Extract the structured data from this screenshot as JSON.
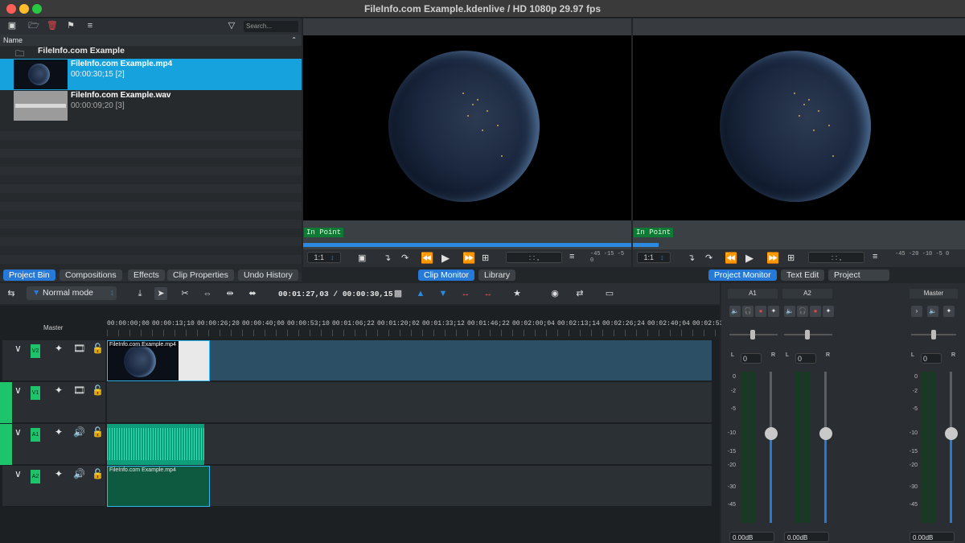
{
  "window": {
    "title": "FileInfo.com Example.kdenlive / HD 1080p 29.97 fps"
  },
  "bin": {
    "search_placeholder": "Search...",
    "column_header": "Name",
    "folder": "FileInfo.com Example",
    "clips": [
      {
        "name": "FileInfo.com Example.mp4",
        "duration": "00:00:30;15 [2]"
      },
      {
        "name": "FileInfo.com Example.wav",
        "duration": "00:00:09;20 [3]"
      }
    ],
    "tabs": [
      "Project Bin",
      "Compositions",
      "Effects",
      "Clip Properties",
      "Undo History"
    ]
  },
  "clip_monitor": {
    "in_point": "In Point",
    "zoom": "1:1",
    "timecode": ": : ,",
    "meter_labels": [
      "-45",
      "-15",
      "-5",
      "0"
    ],
    "tabs": [
      "Clip Monitor",
      "Library"
    ]
  },
  "project_monitor": {
    "in_point": "In Point",
    "zoom": "1:1",
    "timecode": ": : ,",
    "meter_labels": [
      "-45",
      "-20",
      "-10",
      "-5",
      "0"
    ],
    "tabs": [
      "Project Monitor",
      "Text Edit",
      "Project Notes"
    ]
  },
  "timeline": {
    "mode": "Normal mode",
    "timecode": "00:01:27,03 / 00:00:30,15",
    "master_label": "Master",
    "ruler": [
      "00:00:00;00",
      "00:00:13;10",
      "00:00:26;20",
      "00:00:40;00",
      "00:00:53;10",
      "00:01:06;22",
      "00:01:20;02",
      "00:01:33;12",
      "00:01:46;22",
      "00:02:00;04",
      "00:02:13;14",
      "00:02:26;24",
      "00:02:40;04",
      "00:02:53"
    ],
    "tracks": [
      "V2",
      "V1",
      "A1",
      "A2"
    ],
    "clip_v2": "FileInfo.com Example.mp4",
    "clip_a2": "FileInfo.com Example.mp4"
  },
  "mixer": {
    "strips": [
      {
        "name": "A1",
        "balance": "0",
        "volume": "0.00dB"
      },
      {
        "name": "A2",
        "balance": "0",
        "volume": "0.00dB"
      },
      {
        "name": "Master",
        "balance": "0",
        "volume": "0.00dB"
      }
    ],
    "pan_left": "L",
    "pan_right": "R",
    "db_scale": [
      "0",
      "-2",
      "-5",
      "-10",
      "-15",
      "-20",
      "-30",
      "-45"
    ]
  }
}
